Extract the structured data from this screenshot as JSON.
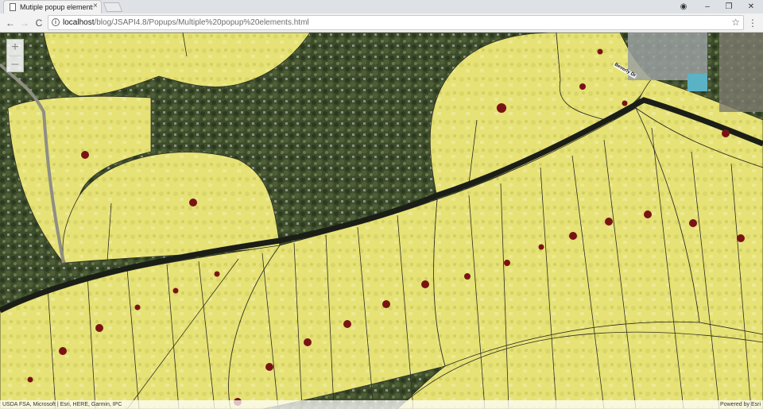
{
  "browser": {
    "tab_title": "Mutiple popup elements",
    "tab_close": "×",
    "url_host": "localhost",
    "url_path": "/blog/JSAPI4.8/Popups/Multiple%20popup%20elements.html",
    "controls": {
      "back": "←",
      "forward": "→",
      "reload": "C",
      "star": "☆",
      "menu": "⋮",
      "profile": "◉",
      "minimize": "–",
      "restore": "❐",
      "close": "✕",
      "info": "i"
    }
  },
  "map": {
    "zoom_in": "+",
    "zoom_out": "–",
    "street_label": "Beverly Dr",
    "attribution_left": "USDA FSA, Microsoft | Esri, HERE, Garmin, IPC",
    "attribution_right": "Powered by Esri",
    "colors": {
      "parcel_fill": "#e7e477",
      "parcel_outline": "#2e2e20",
      "point": "#7a1414",
      "imagery_dark": "#3b4a2a",
      "road": "#1b1e17"
    }
  }
}
